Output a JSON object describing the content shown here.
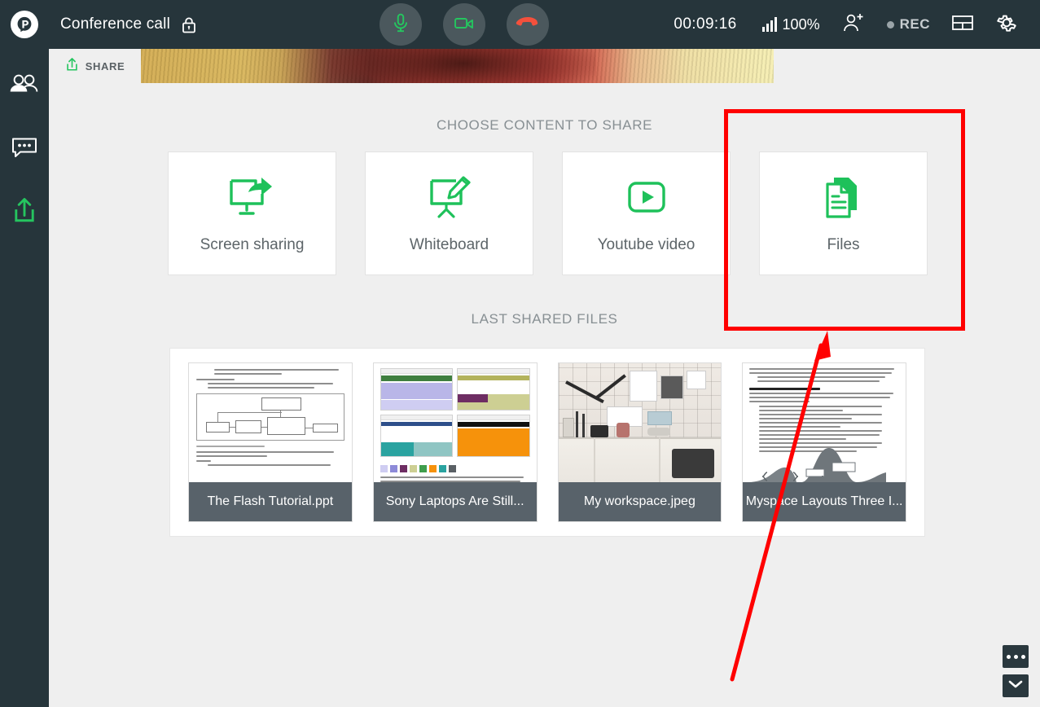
{
  "topbar": {
    "logo_icon": "proficonf-logo-icon",
    "title": "Conference call",
    "lock_icon": "lock-icon",
    "mic_icon": "microphone-icon",
    "camera_icon": "video-camera-icon",
    "hangup_icon": "hangup-phone-icon",
    "timer": "00:09:16",
    "signal_icon": "signal-bars-icon",
    "signal_value": "100%",
    "add_participant_icon": "add-person-icon",
    "rec_label": "REC",
    "layout_icon": "layout-grid-icon",
    "settings_icon": "gear-icon"
  },
  "tabs": [
    {
      "id": "share",
      "label": "SHARE",
      "icon": "share-upload-icon",
      "active": true
    }
  ],
  "rail": {
    "items": [
      {
        "id": "participants",
        "icon": "people-icon",
        "active": false
      },
      {
        "id": "chat",
        "icon": "chat-bubble-icon",
        "active": false
      },
      {
        "id": "share",
        "icon": "share-upload-icon",
        "active": true
      }
    ]
  },
  "main": {
    "choose_title": "CHOOSE CONTENT TO SHARE",
    "last_title": "LAST SHARED FILES",
    "share_options": [
      {
        "id": "screen-sharing",
        "label": "Screen sharing",
        "icon": "screen-share-icon"
      },
      {
        "id": "whiteboard",
        "label": "Whiteboard",
        "icon": "whiteboard-pencil-icon"
      },
      {
        "id": "youtube-video",
        "label": "Youtube video",
        "icon": "play-button-icon"
      },
      {
        "id": "files",
        "label": "Files",
        "icon": "documents-icon"
      }
    ],
    "files": [
      {
        "id": "file-1",
        "name": "The Flash Tutorial.ppt",
        "thumb": "uml-document-thumbnail"
      },
      {
        "id": "file-2",
        "name": "Sony Laptops Are Still...",
        "thumb": "web-layouts-thumbnail"
      },
      {
        "id": "file-3",
        "name": "My workspace.jpeg",
        "thumb": "workspace-photo-thumbnail"
      },
      {
        "id": "file-4",
        "name": "Myspace Layouts Three I...",
        "thumb": "tech-curve-document-thumbnail"
      }
    ]
  },
  "bottom_right": {
    "more_icon": "more-dots-icon",
    "collapse_icon": "chevron-down-icon"
  },
  "annotation": {
    "highlight_target": "files",
    "box_color": "#ff0000",
    "arrow_color": "#ff0000"
  },
  "colors": {
    "topbar_bg": "#26353b",
    "accent_green": "#20bf55",
    "page_bg": "#efefef",
    "card_bg": "#ffffff",
    "file_caption_bg": "#58626a",
    "hangup_red": "#f4503c"
  }
}
